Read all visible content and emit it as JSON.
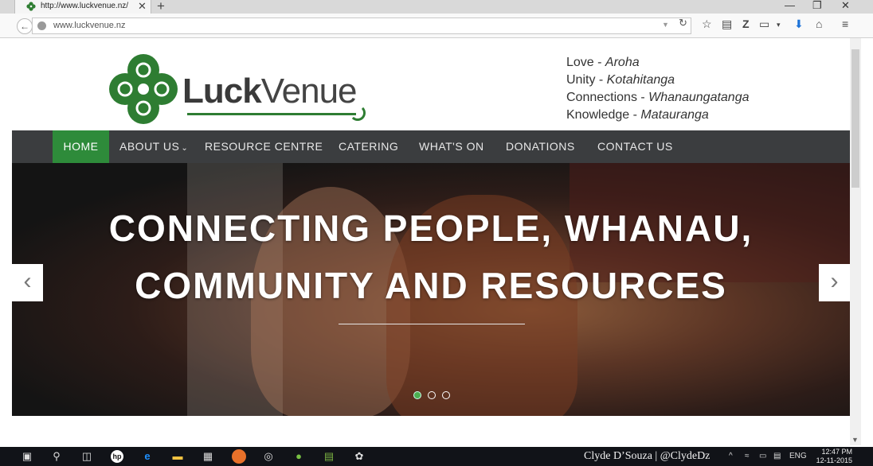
{
  "browser": {
    "tab_title": "http://www.luckvenue.nz/",
    "tab_close": "✕",
    "new_tab": "+",
    "address": "www.luckvenue.nz",
    "window_controls": {
      "minimize": "—",
      "restore": "❐",
      "close": "✕"
    },
    "toolbar_icons": [
      "star-icon",
      "reading-list-icon",
      "zotero-icon",
      "pocket-icon",
      "download-icon",
      "home-icon",
      "menu-icon"
    ]
  },
  "site": {
    "logo": {
      "bold": "Luck",
      "light": "Venue"
    },
    "values": [
      {
        "en": "Love - ",
        "mi": "Aroha"
      },
      {
        "en": "Unity - ",
        "mi": "Kotahitanga"
      },
      {
        "en": "Connections - ",
        "mi": "Whanaungatanga"
      },
      {
        "en": "Knowledge - ",
        "mi": "Matauranga"
      }
    ],
    "nav": {
      "home": "HOME",
      "about": "ABOUT US",
      "resource": "RESOURCE CENTRE",
      "catering": "CATERING",
      "whatson": "WHAT'S ON",
      "donations": "DONATIONS",
      "contact": "CONTACT US"
    },
    "hero": {
      "line1": "CONNECTING PEOPLE, WHANAU,",
      "line2": "COMMUNITY AND RESOURCES",
      "prev": "‹",
      "next": "›",
      "slides": 3,
      "active_slide": 1
    }
  },
  "taskbar": {
    "watermark": "Clyde D’Souza | @ClydeDz",
    "lang": "ENG",
    "time": "12:47 PM",
    "date": "12-11-2015"
  },
  "colors": {
    "brand_green": "#2e8b3a",
    "nav_bg": "#3b3d3f"
  }
}
